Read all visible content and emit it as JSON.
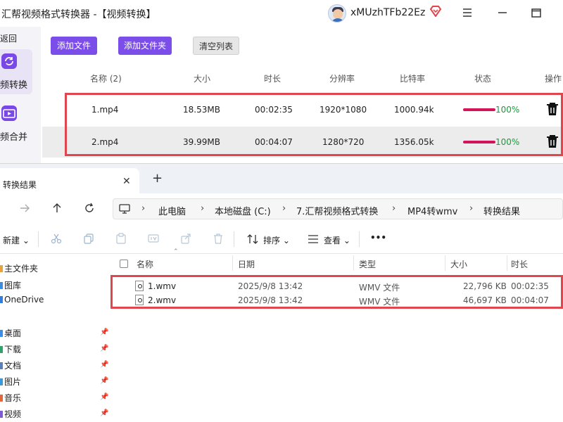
{
  "app": {
    "title": "汇帮视频格式转换器   -【视频转换】",
    "user": {
      "name": "xMUzhTFb22Ez"
    },
    "sidebar": {
      "back_label": "返回",
      "items": [
        {
          "label": "频转换",
          "icon": "video-convert-icon",
          "active": true
        },
        {
          "label": "频合并",
          "icon": "video-merge-icon",
          "active": false
        }
      ]
    },
    "toolbar": {
      "add_file": "添加文件",
      "add_folder": "添加文件夹",
      "clear_list": "清空列表"
    },
    "table": {
      "headers": [
        "名称 (2)",
        "大小",
        "时长",
        "分辨率",
        "比特率",
        "状态",
        "操作"
      ],
      "rows": [
        {
          "name": "1.mp4",
          "size": "18.53MB",
          "duration": "00:02:35",
          "resolution": "1920*1080",
          "bitrate": "1000.94k",
          "progress": 100,
          "status": "100%"
        },
        {
          "name": "2.mp4",
          "size": "39.99MB",
          "duration": "00:04:07",
          "resolution": "1280*720",
          "bitrate": "1356.05k",
          "progress": 100,
          "status": "100%"
        }
      ]
    },
    "colors": {
      "accent": "#7b4eea",
      "progress": "#d4145a",
      "status_text": "#1a9a3c",
      "highlight": "#e0464e"
    }
  },
  "explorer": {
    "tab": {
      "label": "转换结果"
    },
    "breadcrumb": [
      "此电脑",
      "本地磁盘 (C:)",
      "7.汇帮视频格式转换",
      "MP4转wmv",
      "转换结果"
    ],
    "commands": {
      "new": "新建",
      "sort": "排序",
      "view": "查看",
      "more": "•••"
    },
    "nav": {
      "items": [
        {
          "label": "主文件夹",
          "icon": "home-icon",
          "pinned": false
        },
        {
          "label": "图库",
          "icon": "gallery-icon",
          "pinned": false
        },
        {
          "label": "OneDrive",
          "icon": "cloud-icon",
          "pinned": false
        },
        {
          "label": "桌面",
          "icon": "desktop-icon",
          "pinned": true
        },
        {
          "label": "下载",
          "icon": "download-icon",
          "pinned": true
        },
        {
          "label": "文档",
          "icon": "document-icon",
          "pinned": true
        },
        {
          "label": "图片",
          "icon": "picture-icon",
          "pinned": true
        },
        {
          "label": "音乐",
          "icon": "music-icon",
          "pinned": true
        },
        {
          "label": "视频",
          "icon": "video-icon",
          "pinned": true
        }
      ]
    },
    "columns": [
      "名称",
      "日期",
      "类型",
      "大小",
      "时长"
    ],
    "files": [
      {
        "name": "1.wmv",
        "date": "2025/9/8 13:42",
        "type": "WMV 文件",
        "size": "22,796 KB",
        "duration": "00:02:35"
      },
      {
        "name": "2.wmv",
        "date": "2025/9/8 13:42",
        "type": "WMV 文件",
        "size": "46,697 KB",
        "duration": "00:04:07"
      }
    ]
  }
}
